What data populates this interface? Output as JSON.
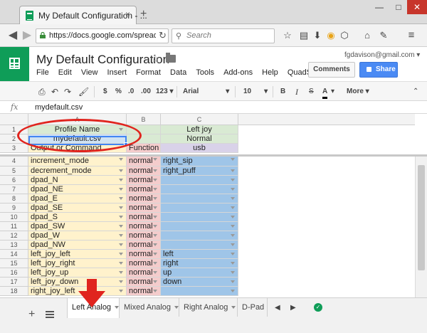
{
  "browser": {
    "tab_title": "My Default Configuration - ...",
    "tab_close": "×",
    "new_tab": "+",
    "url": "https://docs.google.com/spreadshee",
    "search_placeholder": "Search",
    "window_controls": {
      "minimize": "—",
      "maximize": "□",
      "close": "✕"
    }
  },
  "app": {
    "doc_title": "My Default Configuration",
    "user_email": "fgdavison@gmail.com",
    "menu": [
      "File",
      "Edit",
      "View",
      "Insert",
      "Format",
      "Data",
      "Tools",
      "Add-ons",
      "Help",
      "QuadStick"
    ],
    "comments_label": "Comments",
    "share_label": "Share"
  },
  "format_toolbar": {
    "currency": "$",
    "percent": "%",
    "decrease_decimals": ".0",
    "increase_decimals": ".00",
    "more_formats": "123",
    "font": "Arial",
    "font_size": "10",
    "bold": "B",
    "italic": "I",
    "strike": "S",
    "text_color": "A",
    "more": "More"
  },
  "formula_bar": {
    "fx": "fx",
    "value": "mydefault.csv"
  },
  "grid": {
    "columns": [
      "A",
      "B",
      "C"
    ],
    "rows": [
      {
        "n": "1",
        "a": "Profile Name",
        "b": "",
        "c": "Left joy"
      },
      {
        "n": "2",
        "a": "mydefault.csv",
        "b": "",
        "c": "Normal"
      },
      {
        "n": "3",
        "a": "Output or Command",
        "b": "Function",
        "c": "usb"
      },
      {
        "n": "4",
        "a": "increment_mode",
        "b": "normal",
        "c": "right_sip"
      },
      {
        "n": "5",
        "a": "decrement_mode",
        "b": "normal",
        "c": "right_puff"
      },
      {
        "n": "6",
        "a": "dpad_N",
        "b": "normal",
        "c": ""
      },
      {
        "n": "7",
        "a": "dpad_NE",
        "b": "normal",
        "c": ""
      },
      {
        "n": "8",
        "a": "dpad_E",
        "b": "normal",
        "c": ""
      },
      {
        "n": "9",
        "a": "dpad_SE",
        "b": "normal",
        "c": ""
      },
      {
        "n": "10",
        "a": "dpad_S",
        "b": "normal",
        "c": ""
      },
      {
        "n": "11",
        "a": "dpad_SW",
        "b": "normal",
        "c": ""
      },
      {
        "n": "12",
        "a": "dpad_W",
        "b": "normal",
        "c": ""
      },
      {
        "n": "13",
        "a": "dpad_NW",
        "b": "normal",
        "c": ""
      },
      {
        "n": "14",
        "a": "left_joy_left",
        "b": "normal",
        "c": "left"
      },
      {
        "n": "15",
        "a": "left_joy_right",
        "b": "normal",
        "c": "right"
      },
      {
        "n": "16",
        "a": "left_joy_up",
        "b": "normal",
        "c": "up"
      },
      {
        "n": "17",
        "a": "left_joy_down",
        "b": "normal",
        "c": "down"
      },
      {
        "n": "18",
        "a": "right_joy_left",
        "b": "normal",
        "c": ""
      }
    ]
  },
  "sheet_tabs": [
    "Left Analog",
    "Mixed Analog",
    "Right Analog",
    "D-Pad"
  ],
  "sheet_add": "+",
  "colors": {
    "header_green": "#d9ead3",
    "selected_blue": "#cfe2f3",
    "command_purple": "#d9d2e9",
    "function_pink": "#f4cccc",
    "col_a_yellow": "#fff2cc",
    "col_b_pink": "#f4cccc",
    "col_c_blue": "#9fc5e8",
    "annotation_red": "#e0241e"
  }
}
